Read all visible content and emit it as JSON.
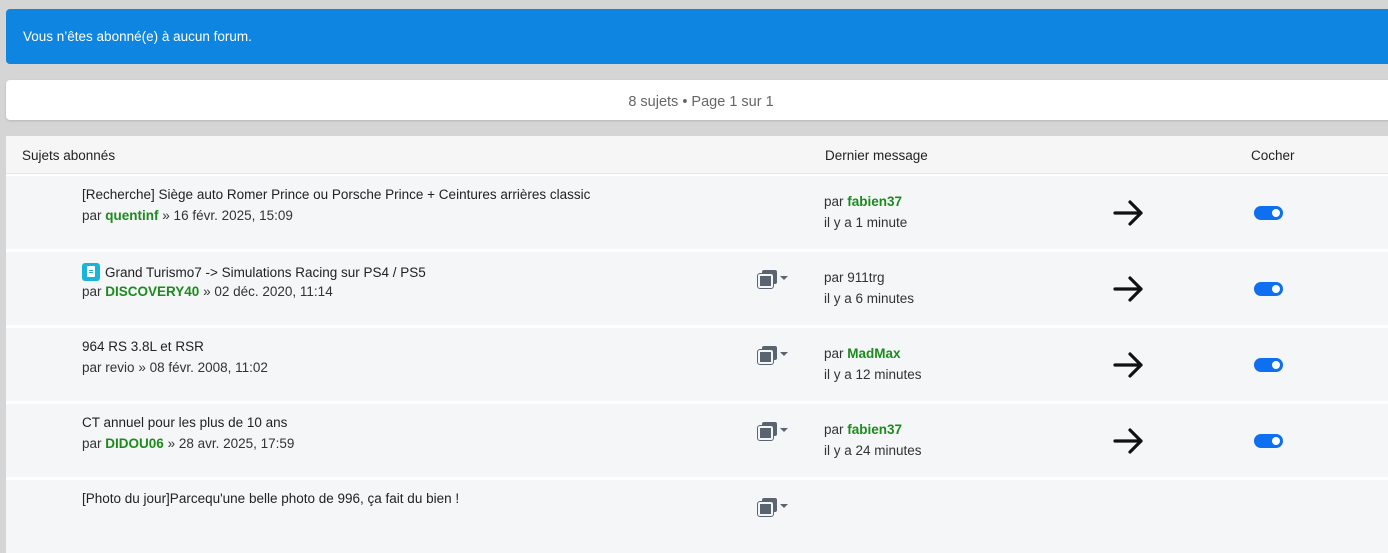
{
  "notice": "Vous n’êtes abonné(e) à aucun forum.",
  "pagination": "8 sujets • Page 1 sur 1",
  "headers": {
    "topics": "Sujets abonnés",
    "last_post": "Dernier message",
    "select": "Cocher"
  },
  "colors": {
    "notice_bg": "#0e85e0",
    "author_green": "#1d8a1d",
    "toggle_blue": "#0e6ff0"
  },
  "rows": [
    {
      "title": "[Recherche] Siège auto Romer Prince ou Porsche Prince + Ceintures arrières classic",
      "by_prefix": "par",
      "author": "quentinf",
      "date": "» 16 févr. 2025, 15:09",
      "last_prefix": "par",
      "last_author": "fabien37",
      "last_time": "il y a 1 minute"
    },
    {
      "title": "Grand Turismo7 -> Simulations Racing sur PS4 / PS5",
      "by_prefix": "par",
      "author": "DISCOVERY40",
      "date": "» 02 déc. 2020, 11:14",
      "last_prefix": "par",
      "last_author": "911trg",
      "last_time": "il y a 6 minutes"
    },
    {
      "title": "964 RS 3.8L et RSR",
      "by_prefix": "par",
      "author": "revio",
      "date": "» 08 févr. 2008, 11:02",
      "last_prefix": "par",
      "last_author": "MadMax",
      "last_time": "il y a 12 minutes"
    },
    {
      "title": "CT annuel pour les plus de 10 ans",
      "by_prefix": "par",
      "author": "DIDOU06",
      "date": "» 28 avr. 2025, 17:59",
      "last_prefix": "par",
      "last_author": "fabien37",
      "last_time": "il y a 24 minutes"
    },
    {
      "title": "[Photo du jour]Parcequ'une belle photo de 996, ça fait du bien !"
    }
  ]
}
